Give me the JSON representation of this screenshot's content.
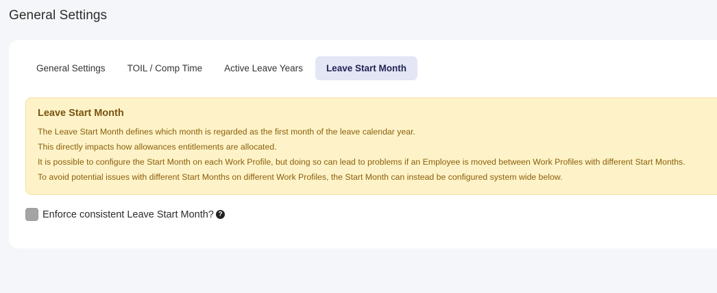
{
  "page": {
    "title": "General Settings"
  },
  "tabs": [
    {
      "label": "General Settings",
      "active": false
    },
    {
      "label": "TOIL / Comp Time",
      "active": false
    },
    {
      "label": "Active Leave Years",
      "active": false
    },
    {
      "label": "Leave Start Month",
      "active": true
    }
  ],
  "notice": {
    "title": "Leave Start Month",
    "lines": [
      "The Leave Start Month defines which month is regarded as the first month of the leave calendar year.",
      "This directly impacts how allowances entitlements are allocated.",
      "It is possible to configure the Start Month on each Work Profile, but doing so can lead to problems if an Employee is moved between Work Profiles with different Start Months.",
      "To avoid potential issues with different Start Months on different Work Profiles, the Start Month can instead be configured system wide below."
    ]
  },
  "enforce": {
    "label": "Enforce consistent Leave Start Month?",
    "checked": false,
    "help_icon": "question-circle-icon",
    "help_glyph": "?"
  },
  "colors": {
    "background": "#f5f6f9",
    "active_tab_bg": "#e4e6f6",
    "notice_bg": "#fef3c8",
    "notice_text": "#8a5e0b"
  }
}
